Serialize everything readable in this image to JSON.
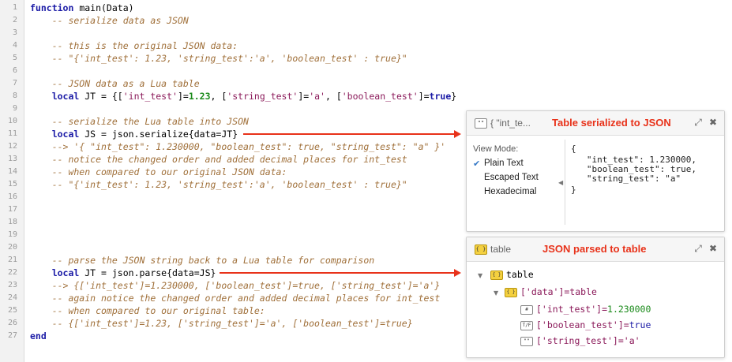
{
  "editor": {
    "line_numbers": [
      "1",
      "2",
      "3",
      "4",
      "5",
      "6",
      "7",
      "8",
      "9",
      "10",
      "11",
      "12",
      "13",
      "14",
      "15",
      "16",
      "17",
      "18",
      "19",
      "20",
      "21",
      "22",
      "23",
      "24",
      "25",
      "26",
      "27"
    ],
    "lines": {
      "l1": {
        "kw": "function",
        "rest": " main(Data)"
      },
      "l2": "    -- serialize data as JSON",
      "l4": "    -- this is the original JSON data:",
      "l5": "    -- \"{'int_test': 1.23, 'string_test':'a', 'boolean_test' : true}\"",
      "l7": "    -- JSON data as a Lua table",
      "l8": {
        "indent": "    ",
        "kw": "local",
        "a": " JT = {[",
        "s1": "'int_test'",
        "b": "]=",
        "n1": "1.23",
        "c": ", [",
        "s2": "'string_test'",
        "d": "]=",
        "s3": "'a'",
        "e": ", [",
        "s4": "'boolean_test'",
        "f": "]=",
        "k2": "true",
        "g": "}"
      },
      "l10": "    -- serialize the Lua table into JSON",
      "l11": {
        "indent": "    ",
        "kw": "local",
        "rest": " JS = json.serialize{data=JT}"
      },
      "l12": "    --> '{ \"int_test\": 1.230000, \"boolean_test\": true, \"string_test\": \"a\" }'",
      "l13": "    -- notice the changed order and added decimal places for int_test",
      "l14": "    -- when compared to our original JSON data:",
      "l15": "    -- \"{'int_test': 1.23, 'string_test':'a', 'boolean_test' : true}\"",
      "l21": "    -- parse the JSON string back to a Lua table for comparison",
      "l22": {
        "indent": "    ",
        "kw": "local",
        "rest": " JT = json.parse{data=JS}"
      },
      "l23": "    --> {['int_test']=1.230000, ['boolean_test']=true, ['string_test']='a'}",
      "l24": "    -- again notice the changed order and added decimal places for int_test",
      "l25": "    -- when compared to our original table:",
      "l26": "    -- {['int_test']=1.23, ['string_test']='a', ['boolean_test']=true}",
      "l27": {
        "kw": "end"
      }
    }
  },
  "panel1": {
    "icon": "string-icon",
    "icon_glyph": "\"\"",
    "tab_label": "{   \"int_te...",
    "annotation": "Table serialized to JSON",
    "pin_glyph": "⤢",
    "close_glyph": "✖",
    "view_mode_label": "View Mode:",
    "options": [
      "Plain Text",
      "Escaped Text",
      "Hexadecimal"
    ],
    "selected_check": "✔",
    "collapse_glyph": "◀",
    "json_lines": [
      "{",
      "   \"int_test\": 1.230000,",
      "   \"boolean_test\": true,",
      "   \"string_test\": \"a\"",
      "}"
    ]
  },
  "panel2": {
    "icon": "table-icon",
    "icon_glyph": "{ }",
    "tab_label": "table",
    "annotation": "JSON parsed to table",
    "pin_glyph": "⤢",
    "close_glyph": "✖",
    "tree": {
      "root": "table",
      "data_key": "['data']=table",
      "items": [
        {
          "icon": "number-icon",
          "glyph": "#",
          "key": "['int_test']=",
          "value": "1.230000",
          "value_color": "#1a8a1a"
        },
        {
          "icon": "boolean-icon",
          "glyph": "T/F",
          "key": "['boolean_test']=",
          "value": "true",
          "value_color": "#1a1aa6"
        },
        {
          "icon": "string-icon",
          "glyph": "\"\"",
          "key": "['string_test']=",
          "value": "'a'",
          "value_color": "#8b1a5a"
        }
      ],
      "expand_glyph": "▼"
    }
  },
  "colors": {
    "annotation": "#e8321a",
    "keyword": "#1a1aa6",
    "comment": "#a0703a",
    "string": "#8b1a5a",
    "number": "#1a8a1a"
  }
}
